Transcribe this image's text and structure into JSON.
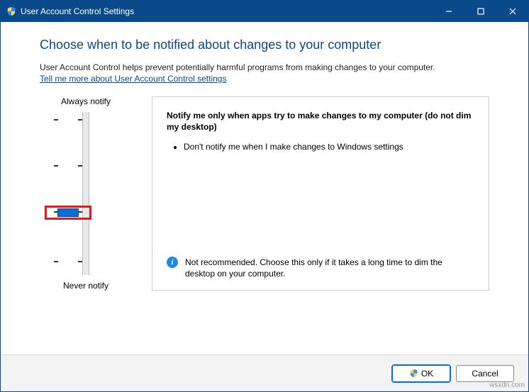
{
  "window": {
    "title": "User Account Control Settings"
  },
  "heading": "Choose when to be notified about changes to your computer",
  "description": "User Account Control helps prevent potentially harmful programs from making changes to your computer.",
  "link": "Tell me more about User Account Control settings",
  "slider": {
    "top_label": "Always notify",
    "bottom_label": "Never notify",
    "levels": 4,
    "selected_index": 2
  },
  "panel": {
    "title": "Notify me only when apps try to make changes to my computer (do not dim my desktop)",
    "bullets": [
      "Don't notify me when I make changes to Windows settings"
    ],
    "warning": "Not recommended. Choose this only if it takes a long time to dim the desktop on your computer."
  },
  "buttons": {
    "ok": "OK",
    "cancel": "Cancel"
  },
  "watermark": "wsxdn.com"
}
